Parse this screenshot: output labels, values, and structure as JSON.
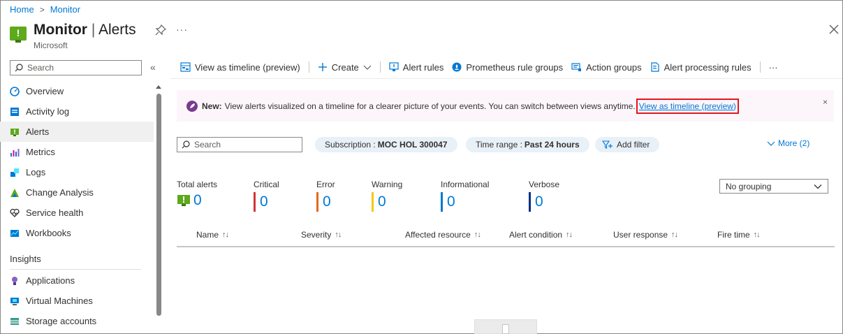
{
  "breadcrumb": {
    "home": "Home",
    "separator": ">",
    "current": "Monitor"
  },
  "header": {
    "title_main": "Monitor",
    "title_divider": " | ",
    "title_sub": "Alerts",
    "subtitle": "Microsoft",
    "more": "···"
  },
  "sidebar": {
    "search_placeholder": "Search",
    "collapse": "«",
    "items": [
      {
        "label": "Overview",
        "icon": "overview-icon",
        "color": "#0078d4"
      },
      {
        "label": "Activity log",
        "icon": "activity-log-icon",
        "color": "#0078d4"
      },
      {
        "label": "Alerts",
        "icon": "alerts-icon",
        "color": "#5ea91c"
      },
      {
        "label": "Metrics",
        "icon": "metrics-icon",
        "color": "#0078d4"
      },
      {
        "label": "Logs",
        "icon": "logs-icon",
        "color": "#0078d4"
      },
      {
        "label": "Change Analysis",
        "icon": "change-analysis-icon",
        "color": "#5ea91c"
      },
      {
        "label": "Service health",
        "icon": "service-health-icon",
        "color": "#323130"
      },
      {
        "label": "Workbooks",
        "icon": "workbooks-icon",
        "color": "#0078d4"
      }
    ],
    "section_insights": "Insights",
    "insights_items": [
      {
        "label": "Applications",
        "icon": "applications-icon",
        "color": "#8661c5"
      },
      {
        "label": "Virtual Machines",
        "icon": "virtual-machines-icon",
        "color": "#0078d4"
      },
      {
        "label": "Storage accounts",
        "icon": "storage-accounts-icon",
        "color": "#3a9e8f"
      }
    ]
  },
  "toolbar": {
    "timeline": "View as timeline (preview)",
    "create": "Create",
    "alert_rules": "Alert rules",
    "prometheus": "Prometheus rule groups",
    "action_groups": "Action groups",
    "processing_rules": "Alert processing rules",
    "more": "···"
  },
  "banner": {
    "new_label": "New:",
    "text": "View alerts visualized on a timeline for a clearer picture of your events. You can switch between views anytime.",
    "link": "View as timeline (preview)",
    "close": "×"
  },
  "filters": {
    "search_placeholder": "Search",
    "subscription_label": "Subscription :",
    "subscription_value": "MOC HOL 300047",
    "time_label": "Time range :",
    "time_value": "Past 24 hours",
    "add_filter": "Add filter",
    "more": "More (2)"
  },
  "summary": [
    {
      "label": "Total alerts",
      "value": "0",
      "color": "#5ea91c"
    },
    {
      "label": "Critical",
      "value": "0",
      "color": "#d13438"
    },
    {
      "label": "Error",
      "value": "0",
      "color": "#e36a1a"
    },
    {
      "label": "Warning",
      "value": "0",
      "color": "#f2c811"
    },
    {
      "label": "Informational",
      "value": "0",
      "color": "#0078d4"
    },
    {
      "label": "Verbose",
      "value": "0",
      "color": "#002f87"
    }
  ],
  "grouping": {
    "value": "No grouping"
  },
  "table": {
    "columns": [
      "Name",
      "Severity",
      "Affected resource",
      "Alert condition",
      "User response",
      "Fire time"
    ],
    "sort_glyph": "↑↓"
  }
}
